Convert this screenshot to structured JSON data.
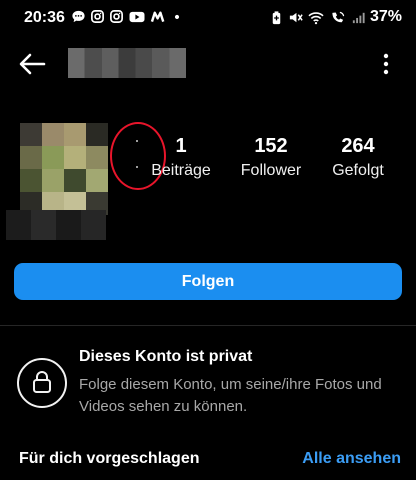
{
  "status_bar": {
    "time": "20:36",
    "battery": "37%",
    "left_icons": [
      "chat-bubble-icon",
      "instagram-icon",
      "instagram-icon",
      "youtube-icon",
      "m-app-icon",
      "dot-icon"
    ],
    "right_icons": [
      "battery-saver-icon",
      "mute-icon",
      "wifi-icon",
      "wifi-calling-icon",
      "signal-icon"
    ]
  },
  "header": {
    "back_icon": "arrow-left-icon",
    "more_icon": "more-vertical-icon"
  },
  "profile": {
    "stats": [
      {
        "value": "1",
        "label": "Beiträge"
      },
      {
        "value": "152",
        "label": "Follower"
      },
      {
        "value": "264",
        "label": "Gefolgt"
      }
    ]
  },
  "actions": {
    "follow_label": "Folgen"
  },
  "private_notice": {
    "icon": "lock-icon",
    "title": "Dieses Konto ist privat",
    "description": "Folge diesem Konto, um seine/ihre Fotos und Videos sehen zu können."
  },
  "suggestions": {
    "title": "Für dich vorgeschlagen",
    "see_all_label": "Alle ansehen"
  },
  "colors": {
    "background": "#000000",
    "primary_button": "#1b8ef0",
    "link": "#3b9df5",
    "annotation_circle": "#e8152b",
    "secondary_text": "#a8a8a8"
  }
}
